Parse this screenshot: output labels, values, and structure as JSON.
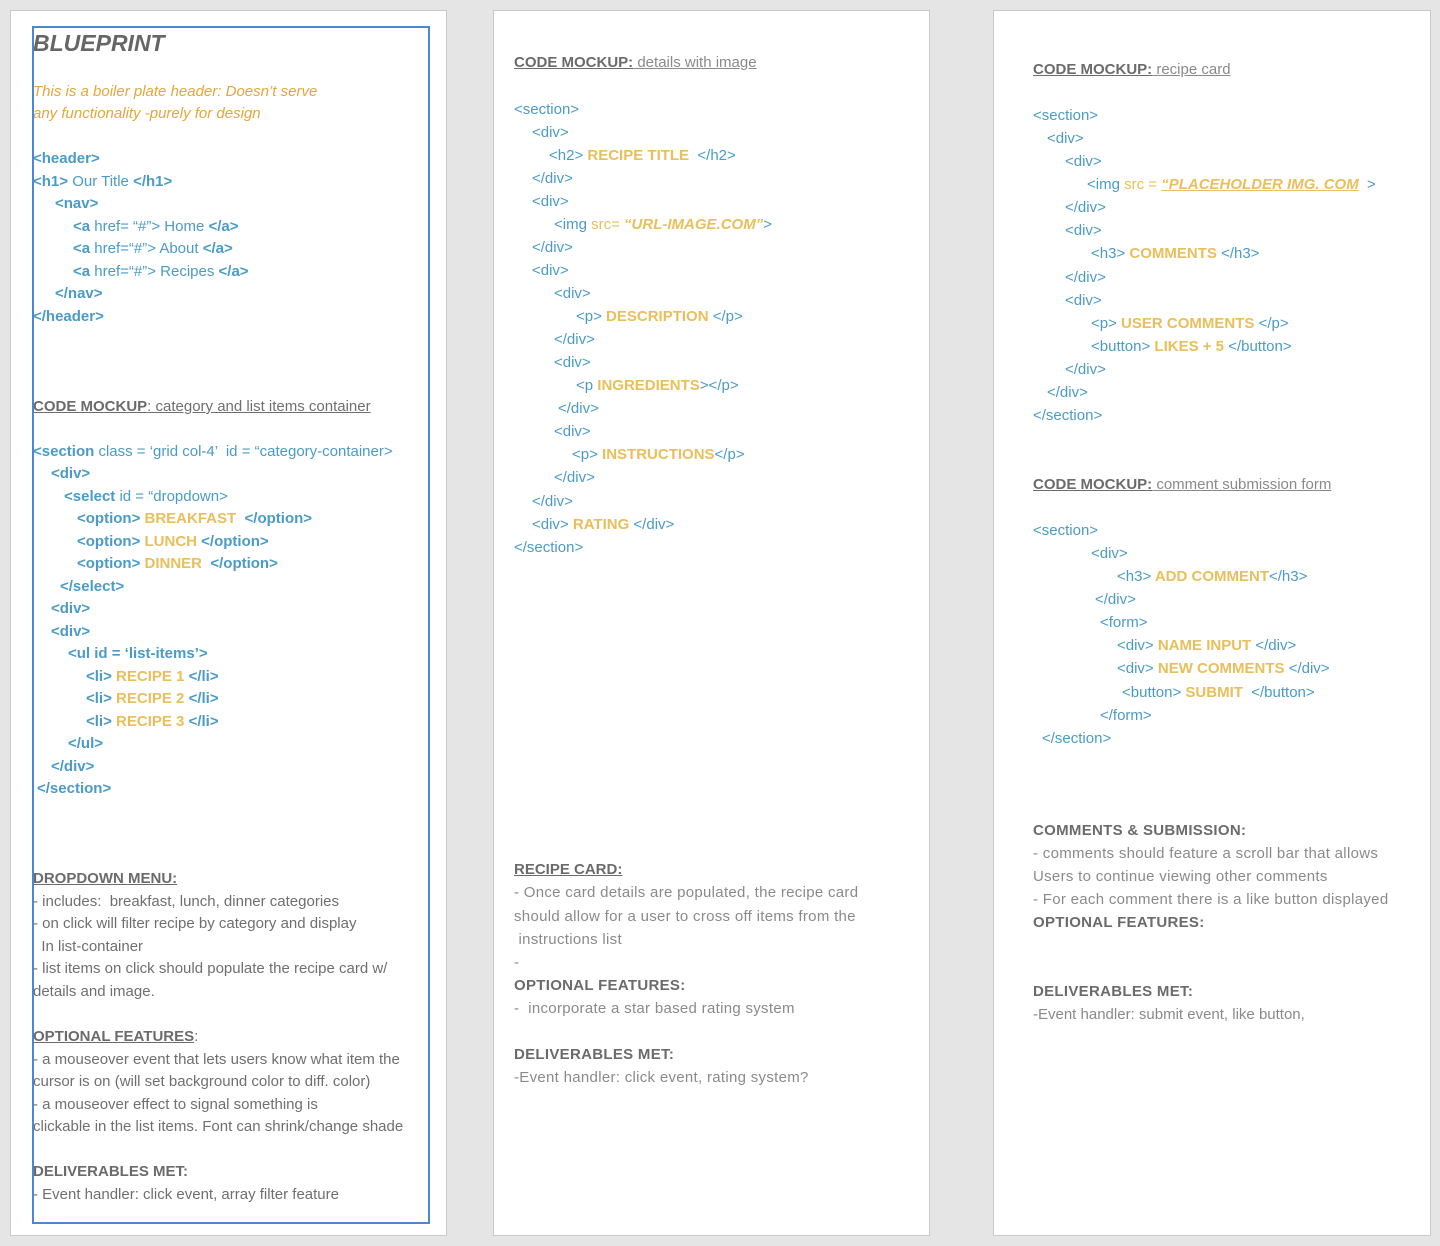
{
  "page1": {
    "title": "BLUEPRINT",
    "note_line1": "This is a boiler plate header: Doesn’t serve",
    "note_line2": "any functionality -purely for design",
    "header_open": "<header>",
    "h1_open": "<h1>",
    "h1_text": " Our Title ",
    "h1_close": "</h1>",
    "nav_open": "<nav>",
    "nav_links": [
      {
        "a_open": "<a",
        "href": " href= “#”> Home ",
        "a_close": "</a>"
      },
      {
        "a_open": "<a",
        "href": " href=“#”> About ",
        "a_close": "</a>"
      },
      {
        "a_open": "<a",
        "href": " href=“#”> Recipes ",
        "a_close": "</a>"
      }
    ],
    "nav_close": "</nav>",
    "header_close": "</header>",
    "mockup_heading_bold": "CODE MOCKUP",
    "mockup_heading_rest": ": category and list items container",
    "section_open_tag": "<section",
    "section_open_attrs": " class = ‘grid col-4’  id = “category-container>",
    "div_open": "<div>",
    "select_open_tag": "<select",
    "select_open_attrs": " id = “dropdown>",
    "options": [
      {
        "open": "<option>",
        "value": " BREAKFAST ",
        "close": " </option>"
      },
      {
        "open": "<option>",
        "value": " LUNCH ",
        "close": "</option>"
      },
      {
        "open": "<option>",
        "value": " DINNER ",
        "close": " </option>"
      }
    ],
    "select_close": "</select>",
    "div_open_2": "<div>",
    "div_open_3": "<div>",
    "ul_open": "<ul id = ‘list-items’>",
    "list_items": [
      {
        "open": "<li>",
        "value": " RECIPE 1 ",
        "close": "</li>"
      },
      {
        "open": "<li>",
        "value": " RECIPE 2 ",
        "close": "</li>"
      },
      {
        "open": "<li>",
        "value": " RECIPE 3 ",
        "close": "</li>"
      }
    ],
    "ul_close": "</ul>",
    "div_close": "</div>",
    "section_close": "</section>",
    "dropdown_heading": "DROPDOWN MENU:",
    "dropdown_lines": [
      "- includes:  breakfast, lunch, dinner categories",
      "- on click will filter recipe by category and display",
      "  In list-container",
      "- list items on click should populate the recipe card w/",
      "details and image."
    ],
    "optional_heading": "OPTIONAL FEATURES",
    "optional_colon": ":",
    "optional_lines": [
      "- a mouseover event that lets users know what item the",
      "cursor is on (will set background color to diff. color)",
      "- a mouseover effect to signal something is",
      "clickable in the list items. Font can shrink/change shade"
    ],
    "deliverables_heading": "DELIVERABLES MET:",
    "deliverables_line": "- Event handler: click event, array filter feature"
  },
  "page2": {
    "mockup_heading_bold": "CODE MOCKUP:",
    "mockup_heading_rest": " details with image",
    "section_open": "<section>",
    "div_open": "<div>",
    "h2_open": "<h2>",
    "h2_value": " RECIPE TITLE ",
    "h2_close": " </h2>",
    "div_close": "</div>",
    "img_open": "<img",
    "img_src_attr": " src= ",
    "img_src_value": "“URL-IMAGE.COM”",
    "img_close": ">",
    "p_open": "<p>",
    "description_value": " DESCRIPTION ",
    "p_close": "</p>",
    "p_open_ing": "<p",
    "ingredients_value": " INGREDIENTS",
    "ingredients_close": "></p>",
    "instructions_value": " INSTRUCTIONS",
    "rating_value": " RATING ",
    "section_close": "</section>",
    "recipe_card_heading": "RECIPE CARD:",
    "recipe_card_lines": [
      "- Once card details are populated, the recipe card",
      "should allow for a user to cross off items from the",
      " instructions list",
      "-"
    ],
    "optional_heading": "OPTIONAL FEATURES:",
    "optional_line": "-  incorporate a star based rating system",
    "deliverables_heading": "DELIVERABLES MET:",
    "deliverables_line": "-Event handler: click event, rating system?"
  },
  "page3": {
    "mockup1_heading_bold": "CODE MOCKUP:",
    "mockup1_heading_rest": " recipe card",
    "section_open": "<section>",
    "div_open": "<div>",
    "img_open": "<img",
    "img_src_attr": " src = ",
    "img_src_value": "“PLACEHOLDER IMG. COM",
    "img_close": "  >",
    "div_close": "</div>",
    "h3_open": "<h3>",
    "comments_value": " COMMENTS ",
    "h3_close": "</h3>",
    "p_open": "<p>",
    "user_comments_value": " USER COMMENTS ",
    "p_close": "</p>",
    "button_open": "<button>",
    "likes_value": " LIKES + 5 ",
    "button_close": "</button>",
    "section_close": "</section>",
    "mockup2_heading_bold": "CODE MOCKUP:",
    "mockup2_heading_rest": " comment submission form",
    "add_comment_value": " ADD COMMENT",
    "form_open": "<form>",
    "name_input_value": " NAME INPUT ",
    "new_comments_value": " NEW COMMENTS ",
    "submit_value": " SUBMIT ",
    "button_close_2": " </button>",
    "form_close": "</form>",
    "comments_heading": "COMMENTS & SUBMISSION:",
    "comments_lines": [
      "- comments should feature a scroll bar that allows",
      "Users to continue viewing other comments",
      "- For each comment there is a like button displayed"
    ],
    "optional_heading": "OPTIONAL FEATURES:",
    "deliverables_heading": "DELIVERABLES MET:",
    "deliverables_line": "-Event handler: submit event, like button,"
  }
}
